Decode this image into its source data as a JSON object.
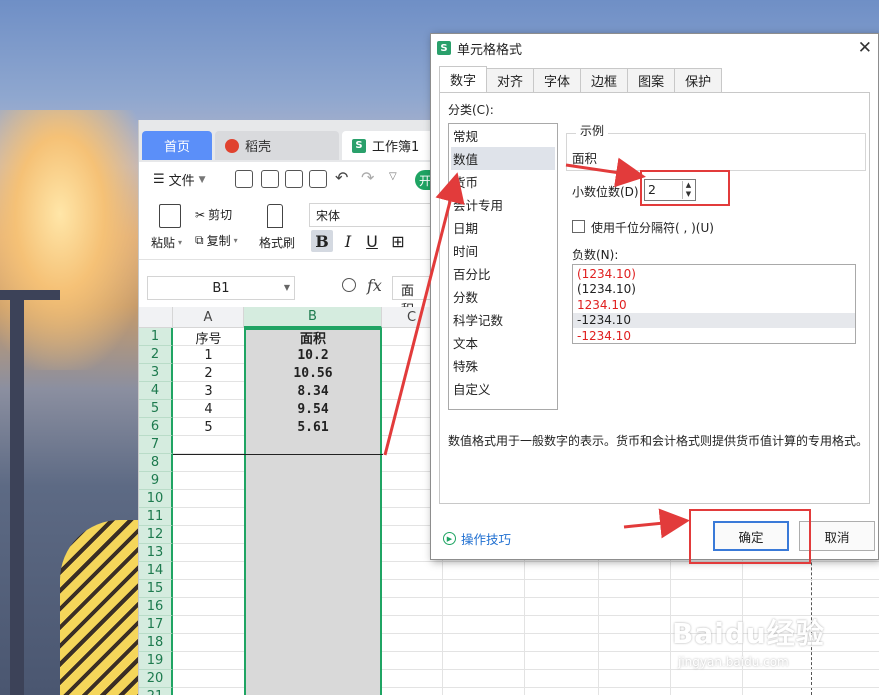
{
  "tabs": {
    "home": "首页",
    "daoke": "稻壳",
    "workbook": "工作簿1"
  },
  "menu": {
    "file": "文件",
    "kai": "开"
  },
  "ribbon": {
    "paste": "粘贴",
    "cut": "剪切",
    "copy": "复制",
    "format_painter": "格式刷",
    "font": "宋体"
  },
  "formula": {
    "name_box": "B1",
    "fx": "fx",
    "content": "面积"
  },
  "sheet": {
    "columns": [
      "A",
      "B",
      "C"
    ],
    "rows": [
      "1",
      "2",
      "3",
      "4",
      "5",
      "6",
      "7",
      "8",
      "9",
      "10",
      "11",
      "12",
      "13",
      "14",
      "15",
      "16",
      "17",
      "18",
      "19",
      "20",
      "21"
    ],
    "header_a": "序号",
    "header_b": "面积",
    "data": [
      {
        "a": "1",
        "b": "10.2"
      },
      {
        "a": "2",
        "b": "10.56"
      },
      {
        "a": "3",
        "b": "8.34"
      },
      {
        "a": "4",
        "b": "9.54"
      },
      {
        "a": "5",
        "b": "5.61"
      }
    ]
  },
  "dialog": {
    "title": "单元格格式",
    "tabs": [
      "数字",
      "对齐",
      "字体",
      "边框",
      "图案",
      "保护"
    ],
    "category_label": "分类(C):",
    "categories": [
      "常规",
      "数值",
      "货币",
      "会计专用",
      "日期",
      "时间",
      "百分比",
      "分数",
      "科学记数",
      "文本",
      "特殊",
      "自定义"
    ],
    "selected_category": "数值",
    "sample_label": "示例",
    "sample_value": "面积",
    "decimal_label": "小数位数(D):",
    "decimal_value": "2",
    "thousands_label": "使用千位分隔符( , )(U)",
    "negative_label": "负数(N):",
    "negatives": [
      {
        "text": "(1234.10)",
        "color": "#e02020"
      },
      {
        "text": "(1234.10)",
        "color": "#222222"
      },
      {
        "text": "1234.10",
        "color": "#e02020"
      },
      {
        "text": "-1234.10",
        "color": "#222222"
      },
      {
        "text": "-1234.10",
        "color": "#e02020"
      }
    ],
    "description": "数值格式用于一般数字的表示。货币和会计格式则提供货币值计算的专用格式。",
    "tips": "操作技巧",
    "ok": "确定",
    "cancel": "取消"
  },
  "watermark": {
    "brand": "Baidu经验",
    "url": "jingyan.baidu.com"
  },
  "colors": {
    "accent": "#1fa463",
    "selection": "#d9d9d9",
    "annotation": "#e23b3b",
    "tab_active": "#5b8ff9"
  }
}
